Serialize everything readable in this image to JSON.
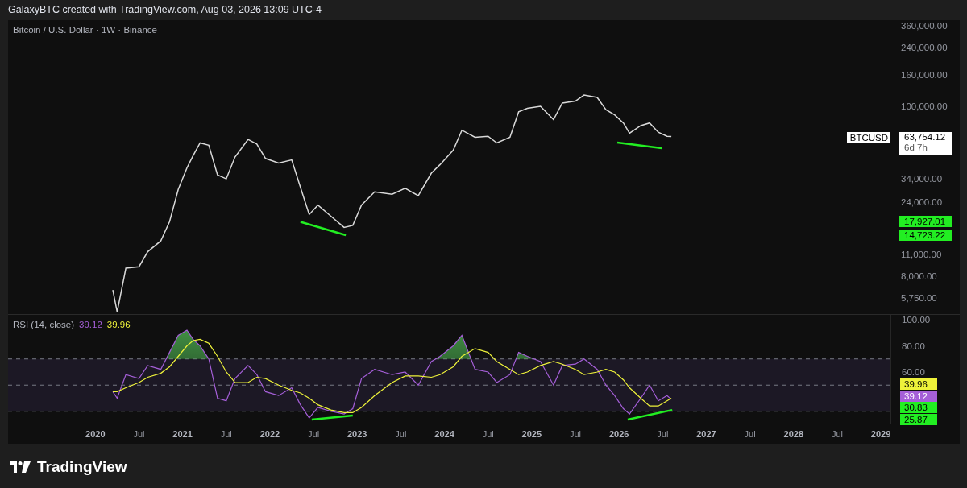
{
  "header": {
    "text": "GalaxyBTC created with TradingView.com, Aug 03, 2026 13:09 UTC-4"
  },
  "price_pane": {
    "legend": "Bitcoin / U.S. Dollar · 1W · Binance",
    "last_price": "63,754.12",
    "countdown": "6d 7h",
    "price_labels": [
      {
        "text": "17,927.01",
        "color": "#22ee22"
      },
      {
        "text": "14,723.22",
        "color": "#22ee22"
      }
    ],
    "symbol_tag": "BTCUSD",
    "kind": "picture",
    "axis_labels": [
      "360,000.00",
      "240,000.00",
      "160,000.00",
      "100,000.00",
      "34,000.00",
      "24,000.00",
      "11,000.00",
      "8,000.00",
      "5,750.00"
    ]
  },
  "rsi_pane": {
    "rsi_value": "39.12",
    "ma_value": "39.96",
    "value_labels": [
      {
        "text": "39.96",
        "color": "#eef23a"
      },
      {
        "text": "39.12",
        "color": "#a55fd8"
      },
      {
        "text": "30.83",
        "color": "#22ee22"
      },
      {
        "text": "25.87",
        "color": "#22ee22"
      }
    ],
    "chart_data": {
      "type": "line",
      "xlim": [
        2019.0,
        2029.11
      ],
      "ylim": [
        20.6,
        103.7
      ],
      "x": [
        2020.2,
        2020.25,
        2020.35,
        2020.5,
        2020.6,
        2020.75,
        2020.85,
        2020.95,
        2021.05,
        2021.12,
        2021.2,
        2021.3,
        2021.4,
        2021.5,
        2021.6,
        2021.75,
        2021.85,
        2021.95,
        2022.1,
        2022.25,
        2022.35,
        2022.45,
        2022.55,
        2022.7,
        2022.85,
        2022.95,
        2023.05,
        2023.2,
        2023.4,
        2023.55,
        2023.7,
        2023.85,
        2023.95,
        2024.1,
        2024.2,
        2024.35,
        2024.5,
        2024.6,
        2024.75,
        2024.85,
        2024.95,
        2025.1,
        2025.25,
        2025.35,
        2025.5,
        2025.6,
        2025.75,
        2025.85,
        2025.95,
        2026.05,
        2026.12,
        2026.25,
        2026.35,
        2026.45,
        2026.55,
        2026.6
      ],
      "series": [
        {
          "name": "RSI (14, close)",
          "color": "#a55fd8",
          "values": [
            45,
            40,
            58,
            55,
            65,
            62,
            75,
            88,
            92,
            85,
            80,
            70,
            40,
            38,
            55,
            65,
            58,
            45,
            42,
            48,
            35,
            25,
            33,
            30,
            28,
            32,
            55,
            62,
            58,
            60,
            50,
            68,
            72,
            80,
            88,
            62,
            60,
            52,
            58,
            75,
            72,
            68,
            50,
            65,
            66,
            70,
            62,
            50,
            42,
            32,
            28,
            40,
            50,
            38,
            42,
            39.12
          ]
        },
        {
          "color": "#eef23a",
          "values": [
            45,
            45,
            48,
            52,
            56,
            59,
            64,
            72,
            80,
            84,
            85,
            82,
            72,
            60,
            52,
            52,
            56,
            55,
            50,
            46,
            44,
            40,
            35,
            31,
            29,
            29,
            33,
            42,
            52,
            57,
            57,
            56,
            58,
            64,
            72,
            78,
            75,
            68,
            62,
            58,
            60,
            65,
            68,
            66,
            62,
            58,
            60,
            62,
            60,
            54,
            48,
            40,
            34,
            34,
            38,
            39.96
          ]
        }
      ],
      "yticks": [
        {
          "value": 100,
          "label": "100.00"
        },
        {
          "value": 80,
          "label": "80.00"
        },
        {
          "value": 60,
          "label": "60.00"
        }
      ],
      "xticks": [
        {
          "value": 2020,
          "label": "2020"
        },
        {
          "value": 2020.5,
          "label": "Jul"
        },
        {
          "value": 2021,
          "label": "2021"
        },
        {
          "value": 2021.5,
          "label": "Jul"
        },
        {
          "value": 2022,
          "label": "2022"
        },
        {
          "value": 2022.5,
          "label": "Jul"
        },
        {
          "value": 2023,
          "label": "2023"
        },
        {
          "value": 2023.5,
          "label": "Jul"
        },
        {
          "value": 2024,
          "label": "2024"
        },
        {
          "value": 2024.5,
          "label": "Jul"
        },
        {
          "value": 2025,
          "label": "2025"
        },
        {
          "value": 2025.5,
          "label": "Jul"
        },
        {
          "value": 2026,
          "label": "2026"
        },
        {
          "value": 2026.5,
          "label": "Jul"
        },
        {
          "value": 2027,
          "label": "2027"
        },
        {
          "value": 2027.5,
          "label": "Jul"
        },
        {
          "value": 2028,
          "label": "2028"
        },
        {
          "value": 2028.5,
          "label": "Jul"
        },
        {
          "value": 2029,
          "label": "2029"
        }
      ]
    }
  },
  "brand": "TradingView"
}
